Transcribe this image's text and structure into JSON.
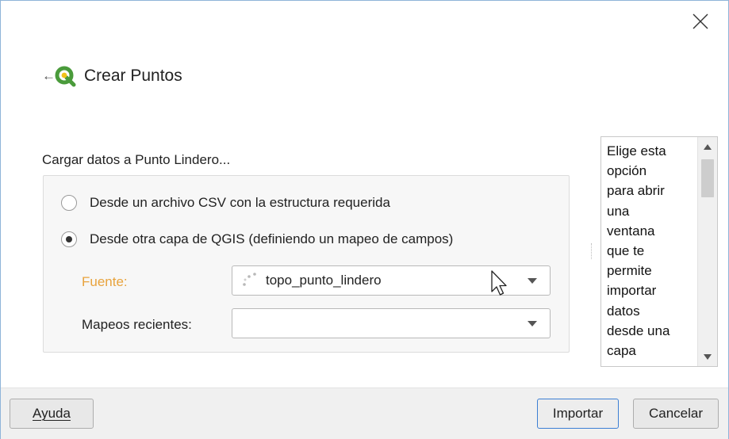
{
  "header": {
    "back_icon": "back-arrow-icon",
    "logo_icon": "qgis-logo-icon",
    "title": "Crear Puntos"
  },
  "section": {
    "title": "Cargar datos a Punto Lindero..."
  },
  "options": [
    {
      "label": "Desde un archivo CSV con la estructura requerida",
      "checked": false
    },
    {
      "label": "Desde otra capa de QGIS (definiendo un mapeo de campos)",
      "checked": true
    }
  ],
  "fields": {
    "source_label": "Fuente:",
    "source_value": "topo_punto_lindero",
    "source_label_color": "#e8a33d",
    "recent_label": "Mapeos recientes:",
    "recent_value": ""
  },
  "help": {
    "text_lines": [
      "Elige esta",
      "opción",
      "para abrir",
      "una",
      "ventana",
      "que te",
      "permite",
      "importar",
      "datos",
      "desde una",
      "capa"
    ]
  },
  "footer": {
    "help_button": "Ayuda",
    "import_button": "Importar",
    "cancel_button": "Cancelar"
  },
  "colors": {
    "accent_blue": "#3c7fd4",
    "qgis_green": "#4a9b3b",
    "qgis_yellow": "#f2c21a"
  }
}
